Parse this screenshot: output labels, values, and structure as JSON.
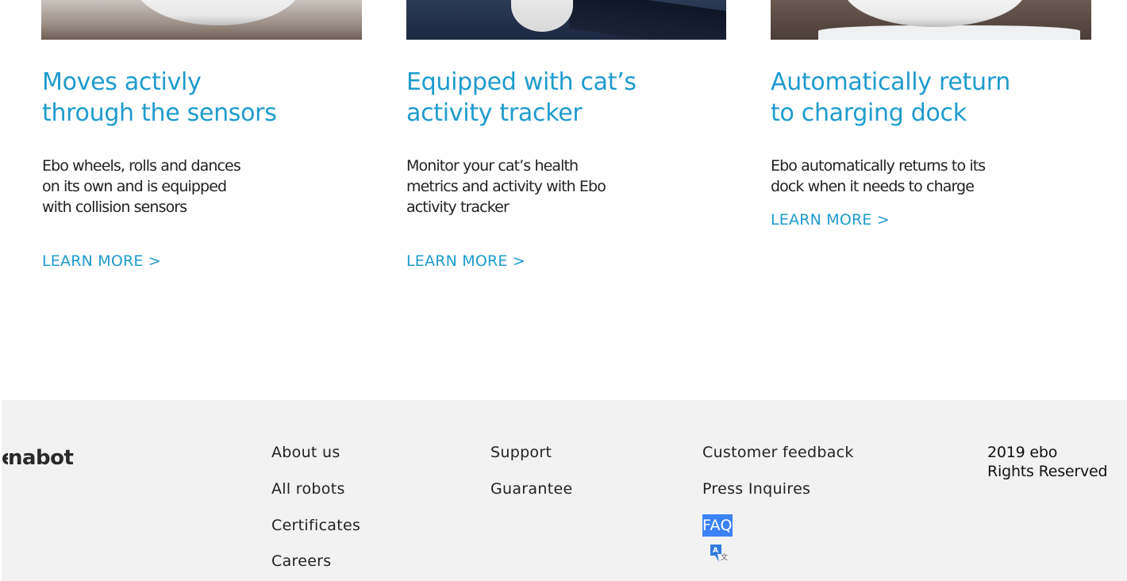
{
  "features": [
    {
      "title": "Moves activly\nthrough the sensors",
      "description": "Ebo wheels, rolls and dances\non its own and is equipped\nwith collision sensors",
      "link": "LEARN MORE >"
    },
    {
      "title": "Equipped with cat’s\nactivity tracker",
      "description": "Monitor your cat’s health\nmetrics and activity with Ebo\nactivity tracker",
      "link": "LEARN MORE >"
    },
    {
      "title": "Automatically return\nto charging dock",
      "description": "Ebo automatically returns to its\ndock when it needs to charge",
      "link": "LEARN MORE >"
    }
  ],
  "footer": {
    "logo_text": "enabot",
    "columns": [
      [
        "About us",
        "All robots",
        "Certificates",
        "Careers"
      ],
      [
        "Support",
        "Guarantee"
      ],
      [
        "Customer feedback",
        "Press Inquires",
        "FAQ"
      ]
    ],
    "copyright": "2019 ebo\nRights Reserved"
  },
  "colors": {
    "accent": "#1e9bcd",
    "footer_bg": "#f2f2f2",
    "selection": "#3b82f6"
  },
  "icons": {
    "translate": "translate-icon"
  }
}
